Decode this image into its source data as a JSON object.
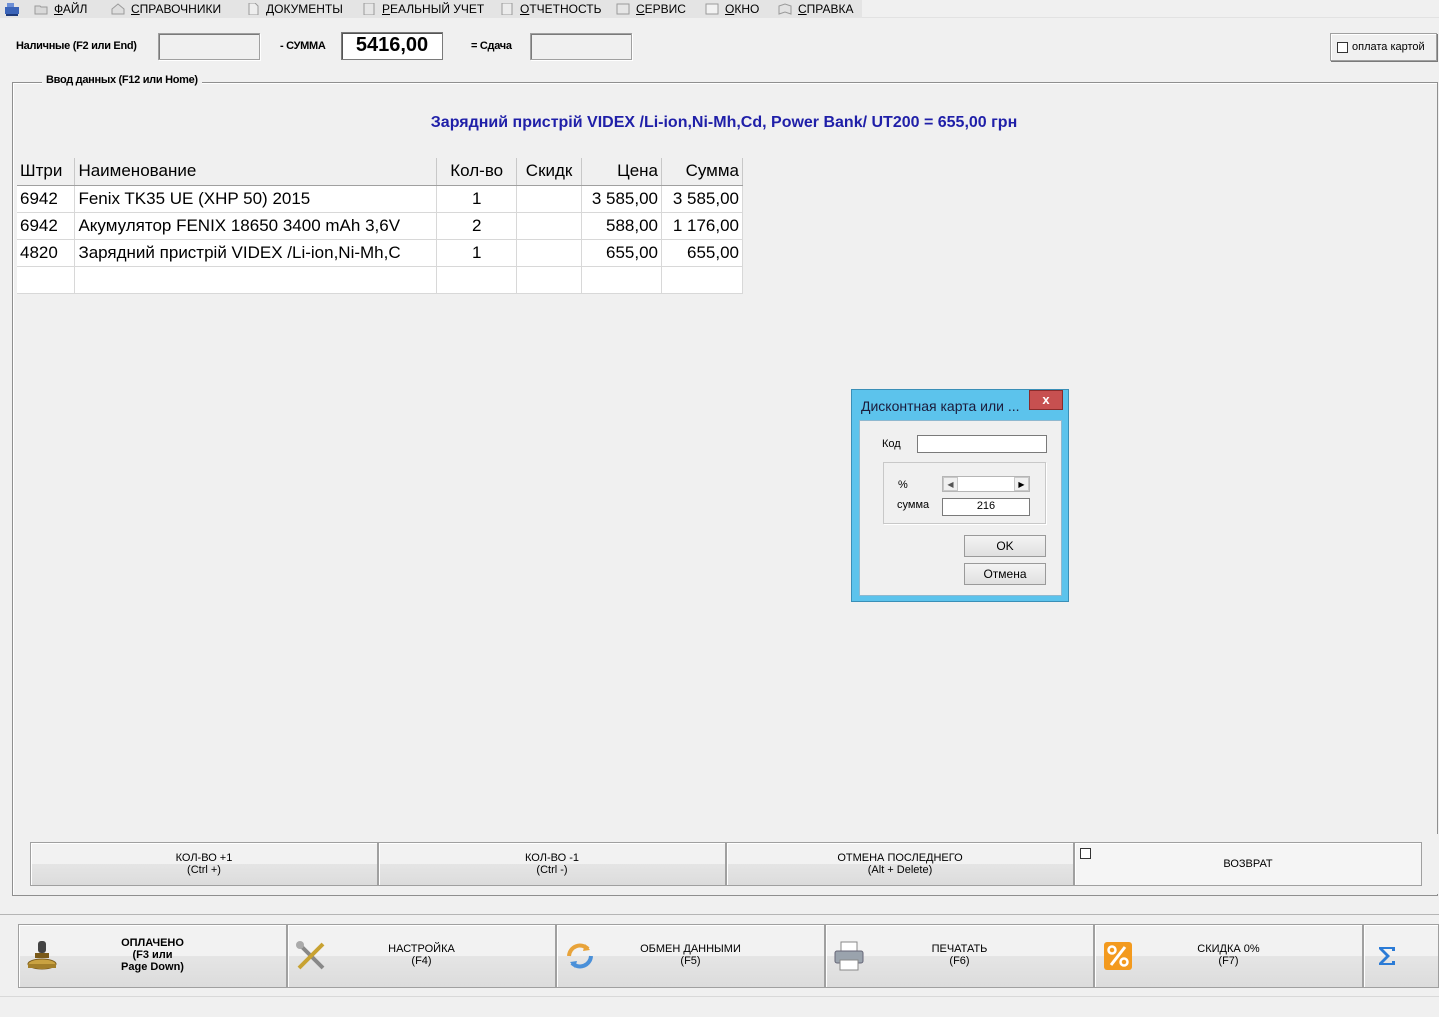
{
  "menu": {
    "items": [
      {
        "label": "ФАЙЛ"
      },
      {
        "label": "СПРАВОЧНИКИ"
      },
      {
        "label": "ДОКУМЕНТЫ"
      },
      {
        "label": "РЕАЛЬНЫЙ УЧЕТ"
      },
      {
        "label": "ОТЧЕТНОСТЬ"
      },
      {
        "label": "СЕРВИС"
      },
      {
        "label": "ОКНО"
      },
      {
        "label": "СПРАВКА"
      }
    ]
  },
  "payment": {
    "cash_label": "Наличные (F2 или End)",
    "cash_value": "",
    "sum_label": "- СУММА",
    "sum_value": "5416,00",
    "change_label": "= Сдача",
    "change_value": "",
    "card_label": "оплата картой",
    "card_checked": false
  },
  "input_group": {
    "title": "Ввод данных (F12 или Home)"
  },
  "info_line": "Зарядний пристрій VIDEX /Li-ion,Ni-Mh,Cd, Power Bank/ UT200   = 655,00 грн",
  "grid": {
    "columns": [
      "Штри",
      "Наименование",
      "Кол-во",
      "Скидк",
      "Цена",
      "Сумма"
    ],
    "rows": [
      {
        "code": "6942",
        "name": "Fenix TK35 UE (XHP 50) 2015",
        "qty": "1",
        "discount": "",
        "price": "3 585,00",
        "sum": "3 585,00"
      },
      {
        "code": "6942",
        "name": "Акумулятор FENIX 18650 3400 mAh 3,6V",
        "qty": "2",
        "discount": "",
        "price": "588,00",
        "sum": "1 176,00"
      },
      {
        "code": "4820",
        "name": "Зарядний  пристрій VIDEX /Li-ion,Ni-Mh,C",
        "qty": "1",
        "discount": "",
        "price": "655,00",
        "sum": "655,00"
      },
      {
        "code": "",
        "name": "",
        "qty": "",
        "discount": "",
        "price": "",
        "sum": ""
      }
    ]
  },
  "action_buttons": {
    "qty_plus": {
      "line1": "КОЛ-ВО +1",
      "line2": "(Ctrl +)"
    },
    "qty_minus": {
      "line1": "КОЛ-ВО -1",
      "line2": "(Ctrl -)"
    },
    "cancel_last": {
      "line1": "ОТМЕНА ПОСЛЕДНЕГО",
      "line2": "(Alt + Delete)"
    },
    "return": {
      "line1": "ВОЗВРАТ",
      "checked": false
    }
  },
  "footer_buttons": {
    "paid": {
      "line1": "ОПЛАЧЕНО",
      "line2": "(F3 или",
      "line3": "Page Down)",
      "icon": "stamp-icon"
    },
    "settings": {
      "line1": "НАСТРОЙКА",
      "line2": "(F4)",
      "icon": "tools-icon"
    },
    "exchange": {
      "line1": "ОБМЕН ДАННЫМИ",
      "line2": "(F5)",
      "icon": "refresh-icon"
    },
    "print": {
      "line1": "ПЕЧАТАТЬ",
      "line2": "(F6)",
      "icon": "printer-icon"
    },
    "discount": {
      "line1": "СКИДКА 0%",
      "line2": "(F7)",
      "icon": "percent-icon"
    },
    "sigma": {
      "icon": "sigma-icon"
    }
  },
  "dialog": {
    "title": "Дисконтная карта или ...",
    "close": "x",
    "code_label": "Код",
    "code_value": "",
    "percent_label": "%",
    "sum_label": "сумма",
    "sum_value": "216",
    "ok_label": "OK",
    "cancel_label": "Отмена"
  },
  "colors": {
    "info_text": "#1f1fa8",
    "dialog_frame": "#5cc3ec",
    "close_button": "#c75050"
  }
}
